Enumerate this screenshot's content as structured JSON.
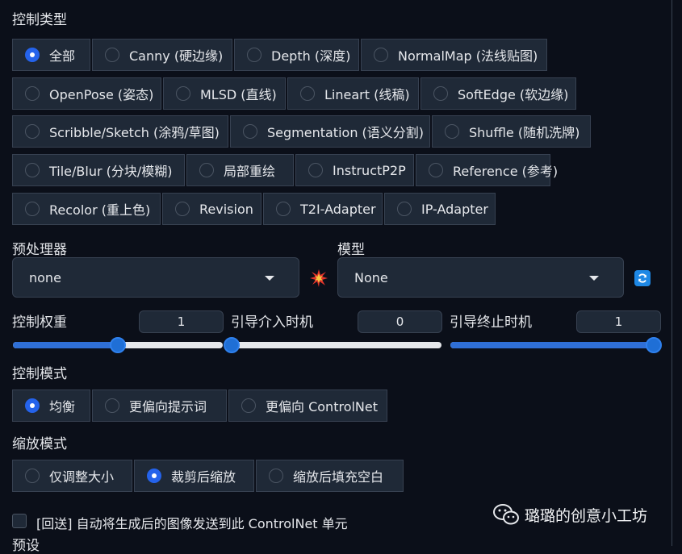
{
  "control_type": {
    "label": "控制类型",
    "rows": [
      [
        {
          "label": "全部",
          "selected": true
        },
        {
          "label": "Canny (硬边缘)",
          "selected": false
        },
        {
          "label": "Depth (深度)",
          "selected": false
        },
        {
          "label": "NormalMap (法线贴图)",
          "selected": false
        }
      ],
      [
        {
          "label": "OpenPose (姿态)",
          "selected": false
        },
        {
          "label": "MLSD (直线)",
          "selected": false
        },
        {
          "label": "Lineart (线稿)",
          "selected": false
        },
        {
          "label": "SoftEdge (软边缘)",
          "selected": false
        }
      ],
      [
        {
          "label": "Scribble/Sketch (涂鸦/草图)",
          "selected": false
        },
        {
          "label": "Segmentation (语义分割)",
          "selected": false
        },
        {
          "label": "Shuffle (随机洗牌)",
          "selected": false
        }
      ],
      [
        {
          "label": "Tile/Blur (分块/模糊)",
          "selected": false
        },
        {
          "label": "局部重绘",
          "selected": false
        },
        {
          "label": "InstructP2P",
          "selected": false
        },
        {
          "label": "Reference (参考)",
          "selected": false
        }
      ],
      [
        {
          "label": "Recolor (重上色)",
          "selected": false
        },
        {
          "label": "Revision",
          "selected": false
        },
        {
          "label": "T2I-Adapter",
          "selected": false
        },
        {
          "label": "IP-Adapter",
          "selected": false
        }
      ]
    ]
  },
  "preprocessor": {
    "label": "预处理器",
    "value": "none"
  },
  "model": {
    "label": "模型",
    "value": "None"
  },
  "icons": {
    "run_preprocessor": "explosion-icon",
    "refresh": "refresh-icon",
    "caret": "chevron-down-icon"
  },
  "sliders": [
    {
      "label": "控制权重",
      "value": "1",
      "fraction": 0.5
    },
    {
      "label": "引导介入时机",
      "value": "0",
      "fraction": 0.0
    },
    {
      "label": "引导终止时机",
      "value": "1",
      "fraction": 1.0
    }
  ],
  "control_mode": {
    "label": "控制模式",
    "options": [
      {
        "label": "均衡",
        "selected": true
      },
      {
        "label": "更偏向提示词",
        "selected": false
      },
      {
        "label": "更偏向 ControlNet",
        "selected": false
      }
    ]
  },
  "resize_mode": {
    "label": "缩放模式",
    "options": [
      {
        "label": "仅调整大小",
        "selected": false
      },
      {
        "label": "裁剪后缩放",
        "selected": true
      },
      {
        "label": "缩放后填充空白",
        "selected": false
      }
    ]
  },
  "loopback": {
    "label": "[回送] 自动将生成后的图像发送到此 ControlNet 单元",
    "checked": false
  },
  "presets_label": "预设",
  "watermark": "璐璐的创意小工坊",
  "colors": {
    "accent": "#2563eb",
    "panel": "#1f2937",
    "border": "#374151",
    "background": "#0b0f19"
  }
}
